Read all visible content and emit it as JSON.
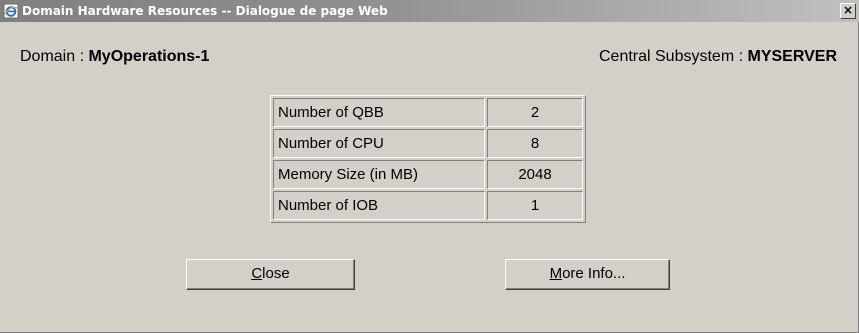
{
  "window": {
    "title": "Domain Hardware Resources -- Dialogue de page Web",
    "close_glyph": "×",
    "icon": "ie-page-icon"
  },
  "header": {
    "domain_label": "Domain : ",
    "domain_value": "MyOperations-1",
    "subsystem_label": "Central Subsystem : ",
    "subsystem_value": "MYSERVER"
  },
  "resources": [
    {
      "label": "Number of QBB",
      "value": "2"
    },
    {
      "label": "Number of CPU",
      "value": "8"
    },
    {
      "label": "Memory Size (in MB)",
      "value": "2048"
    },
    {
      "label": "Number of IOB",
      "value": "1"
    }
  ],
  "buttons": {
    "close": {
      "accel": "C",
      "rest": "lose"
    },
    "more_info": {
      "accel": "M",
      "rest": "ore Info..."
    }
  },
  "colors": {
    "dialog_bg": "#d4d0c8",
    "titlebar_start": "#808080",
    "titlebar_end": "#c0c0c0"
  }
}
